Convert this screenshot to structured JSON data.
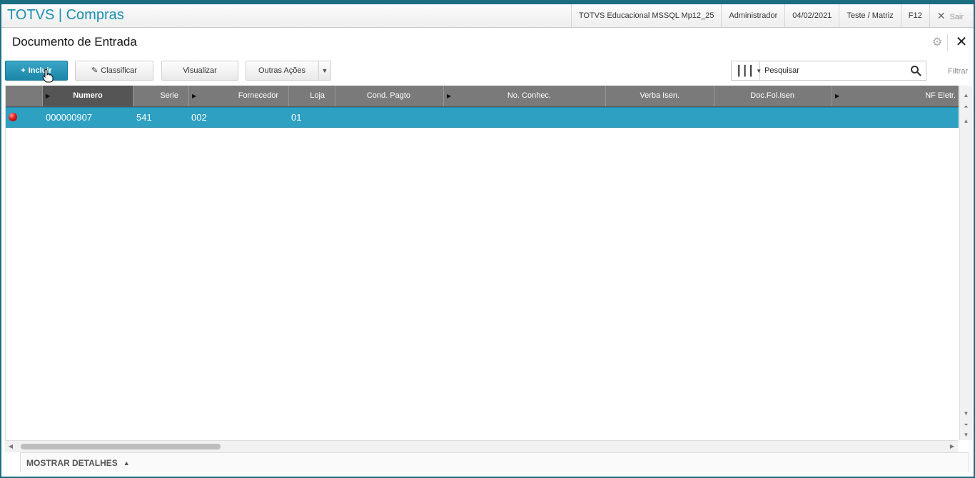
{
  "app": {
    "title": "TOTVS | Compras",
    "environment": "TOTVS Educacional MSSQL Mp12_25",
    "user": "Administrador",
    "date": "04/02/2021",
    "branch": "Teste / Matriz",
    "help_key": "F12",
    "exit_label": "Sair"
  },
  "page": {
    "title": "Documento de Entrada"
  },
  "toolbar": {
    "include_label": "Incluir",
    "classify_label": "Classificar",
    "view_label": "Visualizar",
    "other_actions_label": "Outras Ações"
  },
  "search": {
    "placeholder": "Pesquisar",
    "filter_label": "Filtrar"
  },
  "grid": {
    "columns": [
      {
        "label": "Numero",
        "sorted": true
      },
      {
        "label": "Serie"
      },
      {
        "label": "Fornecedor"
      },
      {
        "label": "Loja"
      },
      {
        "label": "Cond. Pagto"
      },
      {
        "label": "No. Conhec."
      },
      {
        "label": "Verba Isen."
      },
      {
        "label": "Doc.Fol.Isen"
      },
      {
        "label": "NF Eletr."
      }
    ],
    "rows": [
      {
        "status": "red",
        "numero": "000000907",
        "serie": "541",
        "fornecedor": "002",
        "loja": "01",
        "selected": true
      }
    ]
  },
  "details": {
    "label": "MOSTRAR DETALHES"
  },
  "colors": {
    "accent": "#1a8fb0",
    "selected_row": "#2ea0c2",
    "header": "#7a7a7a",
    "status_red": "#e21b1b"
  }
}
